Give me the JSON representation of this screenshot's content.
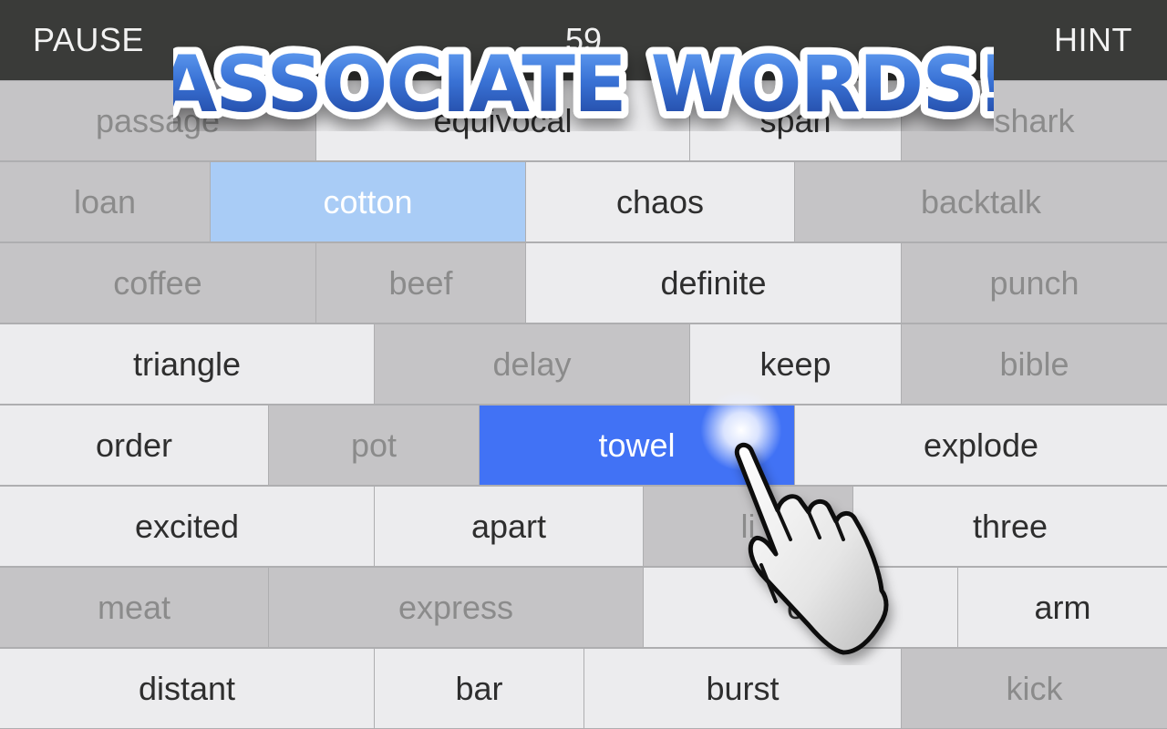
{
  "topbar": {
    "pause_label": "PAUSE",
    "timer": "59",
    "hint_label": "HINT"
  },
  "banner": {
    "title": "ASSOCIATE WORDS!"
  },
  "colors": {
    "topbar_bg": "#3a3b39",
    "cell_active": "#ececee",
    "cell_inactive": "#c5c4c6",
    "selected_first": "#a9ccf6",
    "selected_current": "#4172f5"
  },
  "grid": {
    "rows": [
      {
        "cells": [
          {
            "word": "passage",
            "state": "inactive"
          },
          {
            "word": "equivocal",
            "state": "active"
          },
          {
            "word": "span",
            "state": "active"
          },
          {
            "word": "shark",
            "state": "inactive"
          }
        ]
      },
      {
        "cells": [
          {
            "word": "loan",
            "state": "inactive"
          },
          {
            "word": "cotton",
            "state": "selected-first"
          },
          {
            "word": "chaos",
            "state": "active"
          },
          {
            "word": "backtalk",
            "state": "inactive"
          }
        ]
      },
      {
        "cells": [
          {
            "word": "coffee",
            "state": "inactive"
          },
          {
            "word": "beef",
            "state": "inactive"
          },
          {
            "word": "definite",
            "state": "active"
          },
          {
            "word": "punch",
            "state": "inactive"
          }
        ]
      },
      {
        "cells": [
          {
            "word": "triangle",
            "state": "active"
          },
          {
            "word": "delay",
            "state": "inactive"
          },
          {
            "word": "keep",
            "state": "active"
          },
          {
            "word": "bible",
            "state": "inactive"
          }
        ]
      },
      {
        "cells": [
          {
            "word": "order",
            "state": "active"
          },
          {
            "word": "pot",
            "state": "inactive"
          },
          {
            "word": "towel",
            "state": "selected-current"
          },
          {
            "word": "explode",
            "state": "active"
          }
        ]
      },
      {
        "cells": [
          {
            "word": "excited",
            "state": "active"
          },
          {
            "word": "apart",
            "state": "active"
          },
          {
            "word": "li",
            "state": "inactive"
          },
          {
            "word": "three",
            "state": "active"
          }
        ]
      },
      {
        "cells": [
          {
            "word": "meat",
            "state": "inactive"
          },
          {
            "word": "express",
            "state": "inactive"
          },
          {
            "word": "cr",
            "state": "active"
          },
          {
            "word": "arm",
            "state": "active"
          }
        ]
      },
      {
        "cells": [
          {
            "word": "distant",
            "state": "active"
          },
          {
            "word": "bar",
            "state": "active"
          },
          {
            "word": "burst",
            "state": "active"
          },
          {
            "word": "kick",
            "state": "inactive"
          }
        ]
      }
    ]
  }
}
